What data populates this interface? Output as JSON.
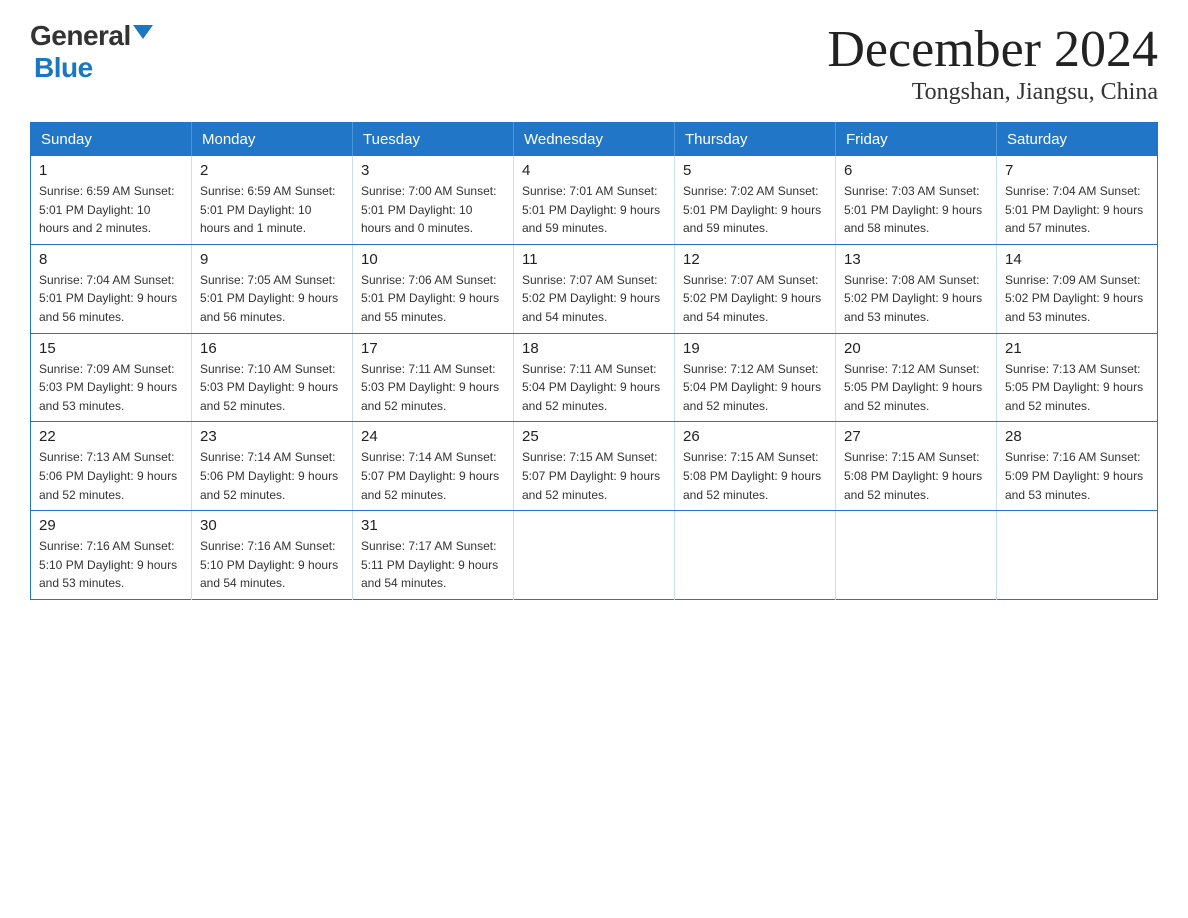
{
  "logo": {
    "general": "General",
    "blue": "Blue",
    "triangle": "▲"
  },
  "header": {
    "month_year": "December 2024",
    "location": "Tongshan, Jiangsu, China"
  },
  "days_of_week": [
    "Sunday",
    "Monday",
    "Tuesday",
    "Wednesday",
    "Thursday",
    "Friday",
    "Saturday"
  ],
  "weeks": [
    [
      {
        "num": "1",
        "info": "Sunrise: 6:59 AM\nSunset: 5:01 PM\nDaylight: 10 hours\nand 2 minutes."
      },
      {
        "num": "2",
        "info": "Sunrise: 6:59 AM\nSunset: 5:01 PM\nDaylight: 10 hours\nand 1 minute."
      },
      {
        "num": "3",
        "info": "Sunrise: 7:00 AM\nSunset: 5:01 PM\nDaylight: 10 hours\nand 0 minutes."
      },
      {
        "num": "4",
        "info": "Sunrise: 7:01 AM\nSunset: 5:01 PM\nDaylight: 9 hours\nand 59 minutes."
      },
      {
        "num": "5",
        "info": "Sunrise: 7:02 AM\nSunset: 5:01 PM\nDaylight: 9 hours\nand 59 minutes."
      },
      {
        "num": "6",
        "info": "Sunrise: 7:03 AM\nSunset: 5:01 PM\nDaylight: 9 hours\nand 58 minutes."
      },
      {
        "num": "7",
        "info": "Sunrise: 7:04 AM\nSunset: 5:01 PM\nDaylight: 9 hours\nand 57 minutes."
      }
    ],
    [
      {
        "num": "8",
        "info": "Sunrise: 7:04 AM\nSunset: 5:01 PM\nDaylight: 9 hours\nand 56 minutes."
      },
      {
        "num": "9",
        "info": "Sunrise: 7:05 AM\nSunset: 5:01 PM\nDaylight: 9 hours\nand 56 minutes."
      },
      {
        "num": "10",
        "info": "Sunrise: 7:06 AM\nSunset: 5:01 PM\nDaylight: 9 hours\nand 55 minutes."
      },
      {
        "num": "11",
        "info": "Sunrise: 7:07 AM\nSunset: 5:02 PM\nDaylight: 9 hours\nand 54 minutes."
      },
      {
        "num": "12",
        "info": "Sunrise: 7:07 AM\nSunset: 5:02 PM\nDaylight: 9 hours\nand 54 minutes."
      },
      {
        "num": "13",
        "info": "Sunrise: 7:08 AM\nSunset: 5:02 PM\nDaylight: 9 hours\nand 53 minutes."
      },
      {
        "num": "14",
        "info": "Sunrise: 7:09 AM\nSunset: 5:02 PM\nDaylight: 9 hours\nand 53 minutes."
      }
    ],
    [
      {
        "num": "15",
        "info": "Sunrise: 7:09 AM\nSunset: 5:03 PM\nDaylight: 9 hours\nand 53 minutes."
      },
      {
        "num": "16",
        "info": "Sunrise: 7:10 AM\nSunset: 5:03 PM\nDaylight: 9 hours\nand 52 minutes."
      },
      {
        "num": "17",
        "info": "Sunrise: 7:11 AM\nSunset: 5:03 PM\nDaylight: 9 hours\nand 52 minutes."
      },
      {
        "num": "18",
        "info": "Sunrise: 7:11 AM\nSunset: 5:04 PM\nDaylight: 9 hours\nand 52 minutes."
      },
      {
        "num": "19",
        "info": "Sunrise: 7:12 AM\nSunset: 5:04 PM\nDaylight: 9 hours\nand 52 minutes."
      },
      {
        "num": "20",
        "info": "Sunrise: 7:12 AM\nSunset: 5:05 PM\nDaylight: 9 hours\nand 52 minutes."
      },
      {
        "num": "21",
        "info": "Sunrise: 7:13 AM\nSunset: 5:05 PM\nDaylight: 9 hours\nand 52 minutes."
      }
    ],
    [
      {
        "num": "22",
        "info": "Sunrise: 7:13 AM\nSunset: 5:06 PM\nDaylight: 9 hours\nand 52 minutes."
      },
      {
        "num": "23",
        "info": "Sunrise: 7:14 AM\nSunset: 5:06 PM\nDaylight: 9 hours\nand 52 minutes."
      },
      {
        "num": "24",
        "info": "Sunrise: 7:14 AM\nSunset: 5:07 PM\nDaylight: 9 hours\nand 52 minutes."
      },
      {
        "num": "25",
        "info": "Sunrise: 7:15 AM\nSunset: 5:07 PM\nDaylight: 9 hours\nand 52 minutes."
      },
      {
        "num": "26",
        "info": "Sunrise: 7:15 AM\nSunset: 5:08 PM\nDaylight: 9 hours\nand 52 minutes."
      },
      {
        "num": "27",
        "info": "Sunrise: 7:15 AM\nSunset: 5:08 PM\nDaylight: 9 hours\nand 52 minutes."
      },
      {
        "num": "28",
        "info": "Sunrise: 7:16 AM\nSunset: 5:09 PM\nDaylight: 9 hours\nand 53 minutes."
      }
    ],
    [
      {
        "num": "29",
        "info": "Sunrise: 7:16 AM\nSunset: 5:10 PM\nDaylight: 9 hours\nand 53 minutes."
      },
      {
        "num": "30",
        "info": "Sunrise: 7:16 AM\nSunset: 5:10 PM\nDaylight: 9 hours\nand 54 minutes."
      },
      {
        "num": "31",
        "info": "Sunrise: 7:17 AM\nSunset: 5:11 PM\nDaylight: 9 hours\nand 54 minutes."
      },
      {
        "num": "",
        "info": ""
      },
      {
        "num": "",
        "info": ""
      },
      {
        "num": "",
        "info": ""
      },
      {
        "num": "",
        "info": ""
      }
    ]
  ]
}
